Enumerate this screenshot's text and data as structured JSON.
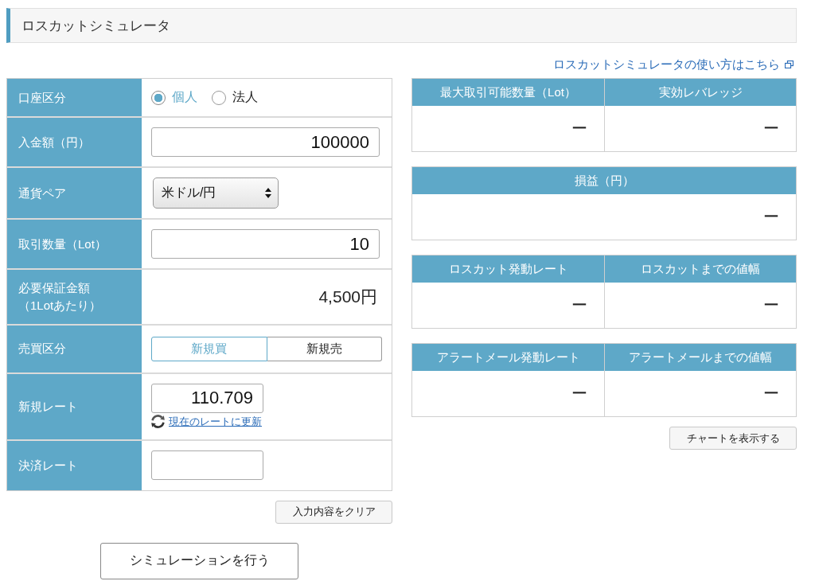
{
  "header": {
    "title": "ロスカットシミュレータ"
  },
  "help_link": {
    "label": "ロスカットシミュレータの使い方はこちら"
  },
  "form": {
    "rows": [
      {
        "kind": "radio",
        "label": "口座区分",
        "options": [
          {
            "label": "個人",
            "selected": true
          },
          {
            "label": "法人",
            "selected": false
          }
        ]
      },
      {
        "kind": "input",
        "label": "入金額（円）",
        "value": "100000"
      },
      {
        "kind": "select",
        "label": "通貨ペア",
        "value": "米ドル/円"
      },
      {
        "kind": "input",
        "label": "取引数量（Lot）",
        "value": "10"
      },
      {
        "kind": "static",
        "label": "必要保証金額（1Lotあたり）",
        "value": "4,500円"
      },
      {
        "kind": "toggle",
        "label": "売買区分",
        "options": [
          {
            "label": "新規買",
            "selected": true
          },
          {
            "label": "新規売",
            "selected": false
          }
        ]
      },
      {
        "kind": "rate",
        "label": "新規レート",
        "value": "110.709",
        "link": "現在のレートに更新"
      },
      {
        "kind": "rate",
        "label": "決済レート"
      }
    ],
    "clear_button": "入力内容をクリア"
  },
  "simulate_button": "シミュレーションを行う",
  "results": {
    "panels": [
      {
        "columns": [
          {
            "heading": "最大取引可能数量（Lot）",
            "value": "ー"
          },
          {
            "heading": "実効レバレッジ",
            "value": "ー"
          }
        ]
      },
      {
        "columns": [
          {
            "heading": "損益（円）",
            "value": "ー"
          }
        ]
      },
      {
        "columns": [
          {
            "heading": "ロスカット発動レート",
            "value": "ー"
          },
          {
            "heading": "ロスカットまでの値幅",
            "value": "ー"
          }
        ]
      },
      {
        "columns": [
          {
            "heading": "アラートメール発動レート",
            "value": "ー"
          },
          {
            "heading": "アラートメールまでの値幅",
            "value": "ー"
          }
        ]
      }
    ],
    "chart_button": "チャートを表示する"
  }
}
